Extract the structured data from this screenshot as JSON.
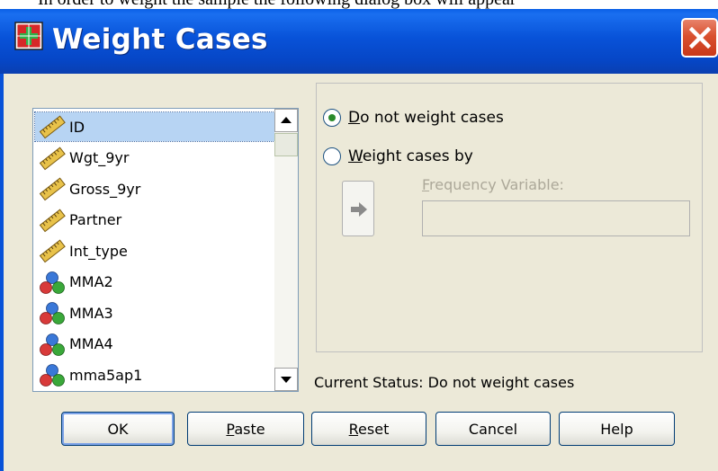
{
  "caption": {
    "text": "In order to weight the sample the following dialog box will appear"
  },
  "window": {
    "title": "Weight Cases"
  },
  "variables": [
    {
      "name": "ID",
      "icon": "scale-ruler-icon",
      "selected": true
    },
    {
      "name": "Wgt_9yr",
      "icon": "scale-ruler-icon",
      "selected": false
    },
    {
      "name": "Gross_9yr",
      "icon": "scale-ruler-icon",
      "selected": false
    },
    {
      "name": "Partner",
      "icon": "scale-ruler-icon",
      "selected": false
    },
    {
      "name": "Int_type",
      "icon": "scale-ruler-icon",
      "selected": false
    },
    {
      "name": "MMA2",
      "icon": "nominal-circles-icon",
      "selected": false
    },
    {
      "name": "MMA3",
      "icon": "nominal-circles-icon",
      "selected": false
    },
    {
      "name": "MMA4",
      "icon": "nominal-circles-icon",
      "selected": false
    },
    {
      "name": "mma5ap1",
      "icon": "nominal-circles-icon",
      "selected": false
    }
  ],
  "options": {
    "do_not_weight": {
      "label_ul": "D",
      "label_rest": "o not weight cases",
      "checked": true
    },
    "weight_by": {
      "label_ul": "W",
      "label_rest": "eight cases by",
      "checked": false
    }
  },
  "frequency": {
    "label_ul": "F",
    "label_rest": "requency Variable:",
    "value": ""
  },
  "status": {
    "text": "Current Status: Do not weight cases"
  },
  "buttons": {
    "ok": "OK",
    "paste_ul": "P",
    "paste_rest": "aste",
    "reset_ul": "R",
    "reset_rest": "eset",
    "cancel": "Cancel",
    "help": "Help"
  },
  "colors": {
    "titlebar": "#0852d8",
    "dialog_bg": "#ece9d8",
    "selection": "#b7d4f3",
    "close": "#d9512f"
  }
}
